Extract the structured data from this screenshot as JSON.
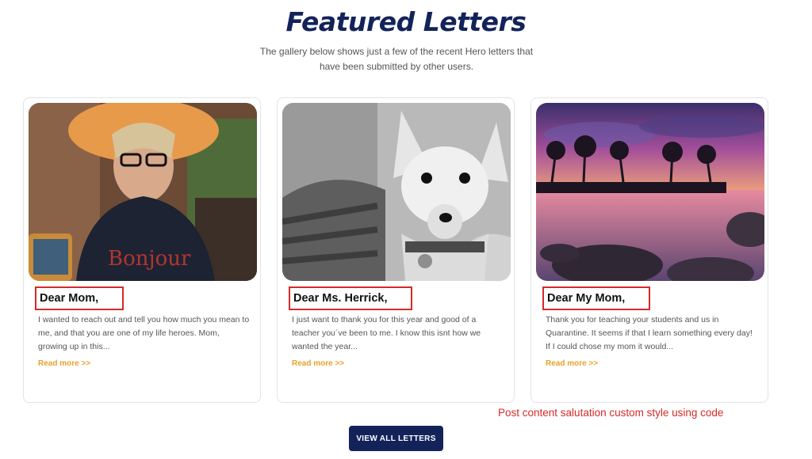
{
  "section": {
    "title": "Featured Letters",
    "subtitle": "The gallery below shows just a few of the recent Hero letters that have been submitted by other users."
  },
  "cards": [
    {
      "image": "woman-in-hat-photo",
      "salutation": "Dear Mom,",
      "excerpt": "I wanted to reach out and tell you how much you mean to me, and that you are one of my life heroes. Mom, growing up in this...",
      "shirt_text": "Bonjour",
      "read_more": "Read more >>"
    },
    {
      "image": "chihuahua-photo",
      "salutation": "Dear Ms. Herrick,",
      "excerpt": "I just want to thank you for this year and good of a teacher you´ve been to me. I know this isnt how we wanted the year...",
      "read_more": "Read more >>"
    },
    {
      "image": "tropical-sunset-photo",
      "salutation": "Dear My Mom,",
      "excerpt": "Thank you for teaching your students and us in Quarantine. It seems if that I learn something every day! If I could chose my mom it would...",
      "read_more": "Read more >>"
    }
  ],
  "annotation": "Post content salutation custom style using code",
  "view_all_label": "VIEW ALL LETTERS",
  "colors": {
    "title": "#13235a",
    "accent": "#e8a22b",
    "button_bg": "#13235a",
    "highlight": "#d42a2a"
  }
}
